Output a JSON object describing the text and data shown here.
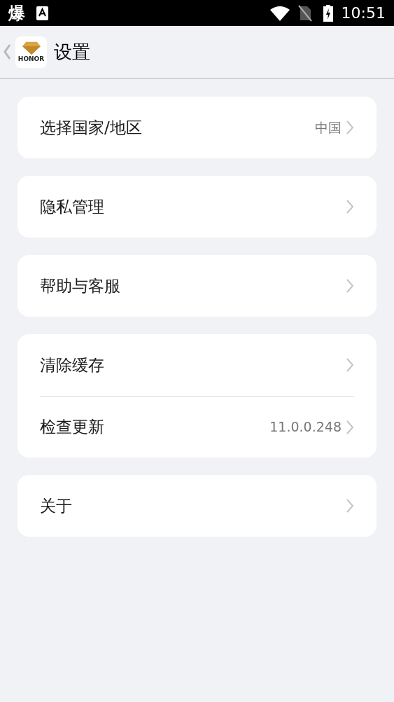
{
  "status_bar": {
    "notification_text": "爆",
    "time": "10:51"
  },
  "header": {
    "logo_text": "HONOR",
    "title": "设置"
  },
  "groups": [
    {
      "items": [
        {
          "label": "选择国家/地区",
          "value": "中国"
        }
      ]
    },
    {
      "items": [
        {
          "label": "隐私管理"
        }
      ]
    },
    {
      "items": [
        {
          "label": "帮助与客服"
        }
      ]
    },
    {
      "items": [
        {
          "label": "清除缓存"
        },
        {
          "label": "检查更新",
          "value": "11.0.0.248"
        }
      ]
    },
    {
      "items": [
        {
          "label": "关于"
        }
      ]
    }
  ]
}
